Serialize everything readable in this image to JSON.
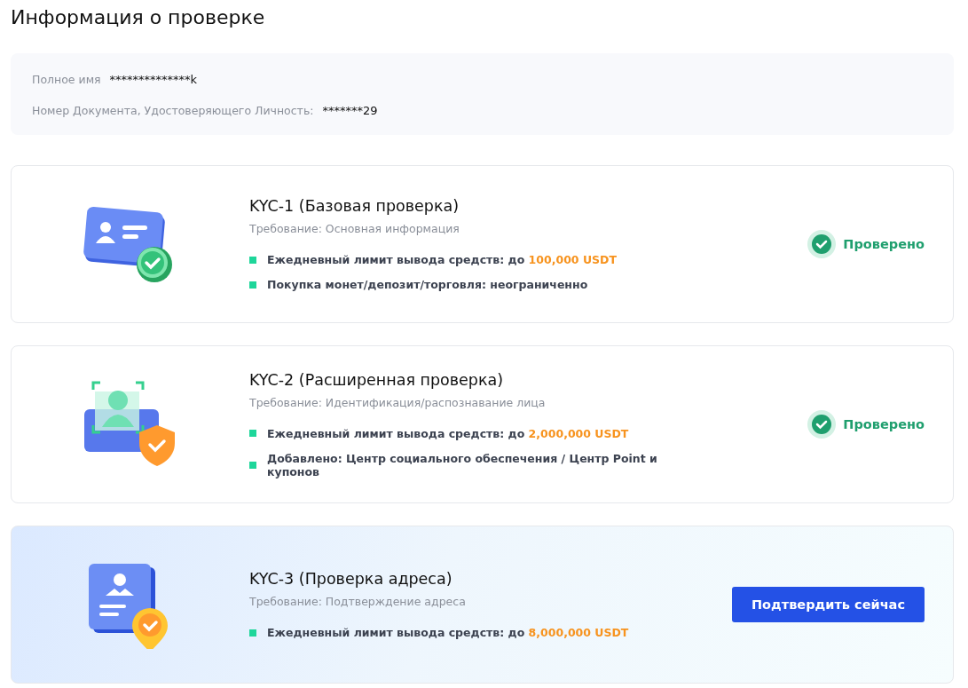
{
  "title": "Информация о проверке",
  "identity": [
    {
      "label": "Полное имя",
      "value": "**************k"
    },
    {
      "label": "Номер Документа, Удостоверяющего Личность:",
      "value": "*******29"
    }
  ],
  "levels": [
    {
      "kind": "id-card",
      "highlighted": false,
      "name": "KYC-1  (Базовая проверка)",
      "requirement": "Требование: Основная информация",
      "benefits": [
        {
          "text": "Ежедневный лимит вывода средств: до",
          "highlight": "100,000 USDT"
        },
        {
          "text": "Покупка монет/депозит/торговля: неограниченно"
        }
      ],
      "status": {
        "kind": "verified",
        "label": "Проверено"
      }
    },
    {
      "kind": "face",
      "highlighted": false,
      "name": "KYC-2  (Расширенная проверка)",
      "requirement": "Требование:  Идентификация/распознавание лица",
      "benefits": [
        {
          "text": "Ежедневный лимит вывода средств: до",
          "highlight": "2,000,000 USDT"
        },
        {
          "text": "Добавлено: Центр социального обеспечения / Центр Point и купонов"
        }
      ],
      "status": {
        "kind": "verified",
        "label": "Проверено"
      }
    },
    {
      "kind": "address",
      "highlighted": true,
      "name": "KYC-3  (Проверка адреса)",
      "requirement": "Требование:  Подтверждение адреса",
      "benefits": [
        {
          "text": "Ежедневный лимит вывода средств: до",
          "highlight": "8,000,000 USDT"
        }
      ],
      "status": {
        "kind": "action",
        "label": "Подтвердить сейчас"
      }
    }
  ]
}
